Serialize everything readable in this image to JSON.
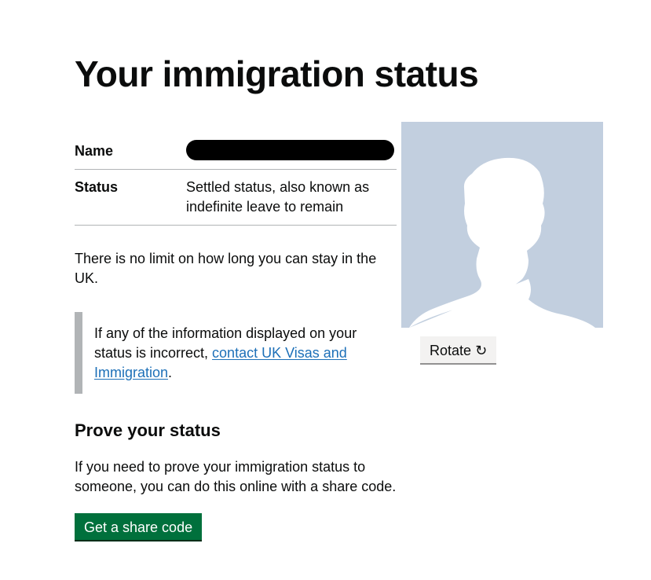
{
  "page": {
    "title": "Your immigration status"
  },
  "summary": {
    "name_label": "Name",
    "status_label": "Status",
    "status_value": "Settled status, also known as indefinite leave to remain"
  },
  "limit_text": "There is no limit on how long you can stay in the UK.",
  "inset": {
    "text_before": "If any of the information displayed on your status is incorrect, ",
    "link_text": "contact UK Visas and Immigration",
    "text_after": "."
  },
  "prove": {
    "heading": "Prove your status",
    "text": "If you need to prove your immigration status to someone, you can do this online with a share code.",
    "button_label": "Get a share code"
  },
  "photo": {
    "rotate_label": "Rotate",
    "rotate_icon": "rotate-clockwise-icon"
  },
  "colors": {
    "primary_button": "#00703c",
    "link": "#1d70b8",
    "inset_border": "#b1b4b6",
    "photo_background": "#c2cfdf"
  }
}
